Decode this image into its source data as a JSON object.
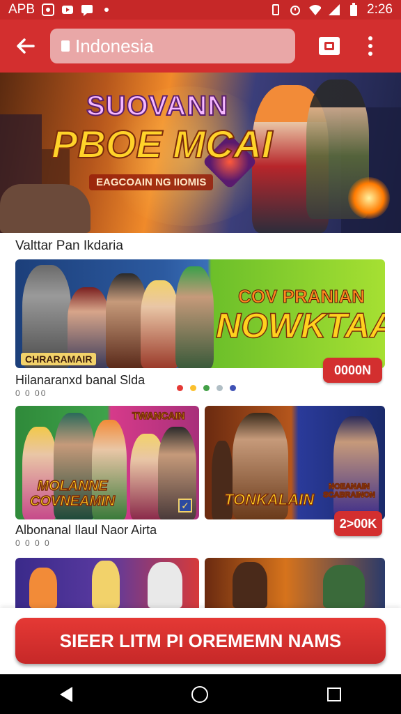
{
  "status_bar": {
    "carrier_label": "APB",
    "time": "2:26",
    "icons": [
      "facebook-icon",
      "youtube-icon",
      "message-icon",
      "vibrate-icon",
      "alarm-icon",
      "wifi-icon",
      "signal-icon",
      "battery-icon"
    ]
  },
  "browser": {
    "url_text": "Indonesia",
    "icons": [
      "back-arrow-icon",
      "lock-icon",
      "tab-switcher-icon",
      "more-vert-icon"
    ]
  },
  "hero_banner": {
    "title_line1": "SUOVANN",
    "title_line2": "PBOE MCAI",
    "subtitle": "EAGCOAIN NG IIOMIS"
  },
  "section_title": "Valttar Pan Ikdaria",
  "featured": {
    "banner_text_top": "COV PRANIAN",
    "banner_text_main": "NOWKTAAN",
    "banner_tag": "CHRARAMAIR",
    "price_label": "0000N",
    "caption": "Hilanaranxd banal Slda",
    "subcaption": "0 0 00",
    "carousel_dots": [
      "#e53935",
      "#fbc02d",
      "#43a047",
      "#b0bec5",
      "#3f51b5"
    ]
  },
  "row2": {
    "left_card_top_text": "TWANCAIN",
    "left_card_text": "MOLANNE COVNEAMIN",
    "right_card_text_main": "TONKALAIN",
    "right_card_text_side": "NOEANAIN SCABRAINON",
    "price_label": "2>00K",
    "caption": "Albonanal Ilaul Naor Airta",
    "subcaption": "0 0 0 0"
  },
  "cta_button": "SIEER LITM PI OREMEMN NAMS",
  "nav_bar": {
    "icons": [
      "nav-back-icon",
      "nav-home-icon",
      "nav-recents-icon"
    ]
  },
  "colors": {
    "brand_red": "#d32f2f",
    "status_red": "#c62828"
  }
}
